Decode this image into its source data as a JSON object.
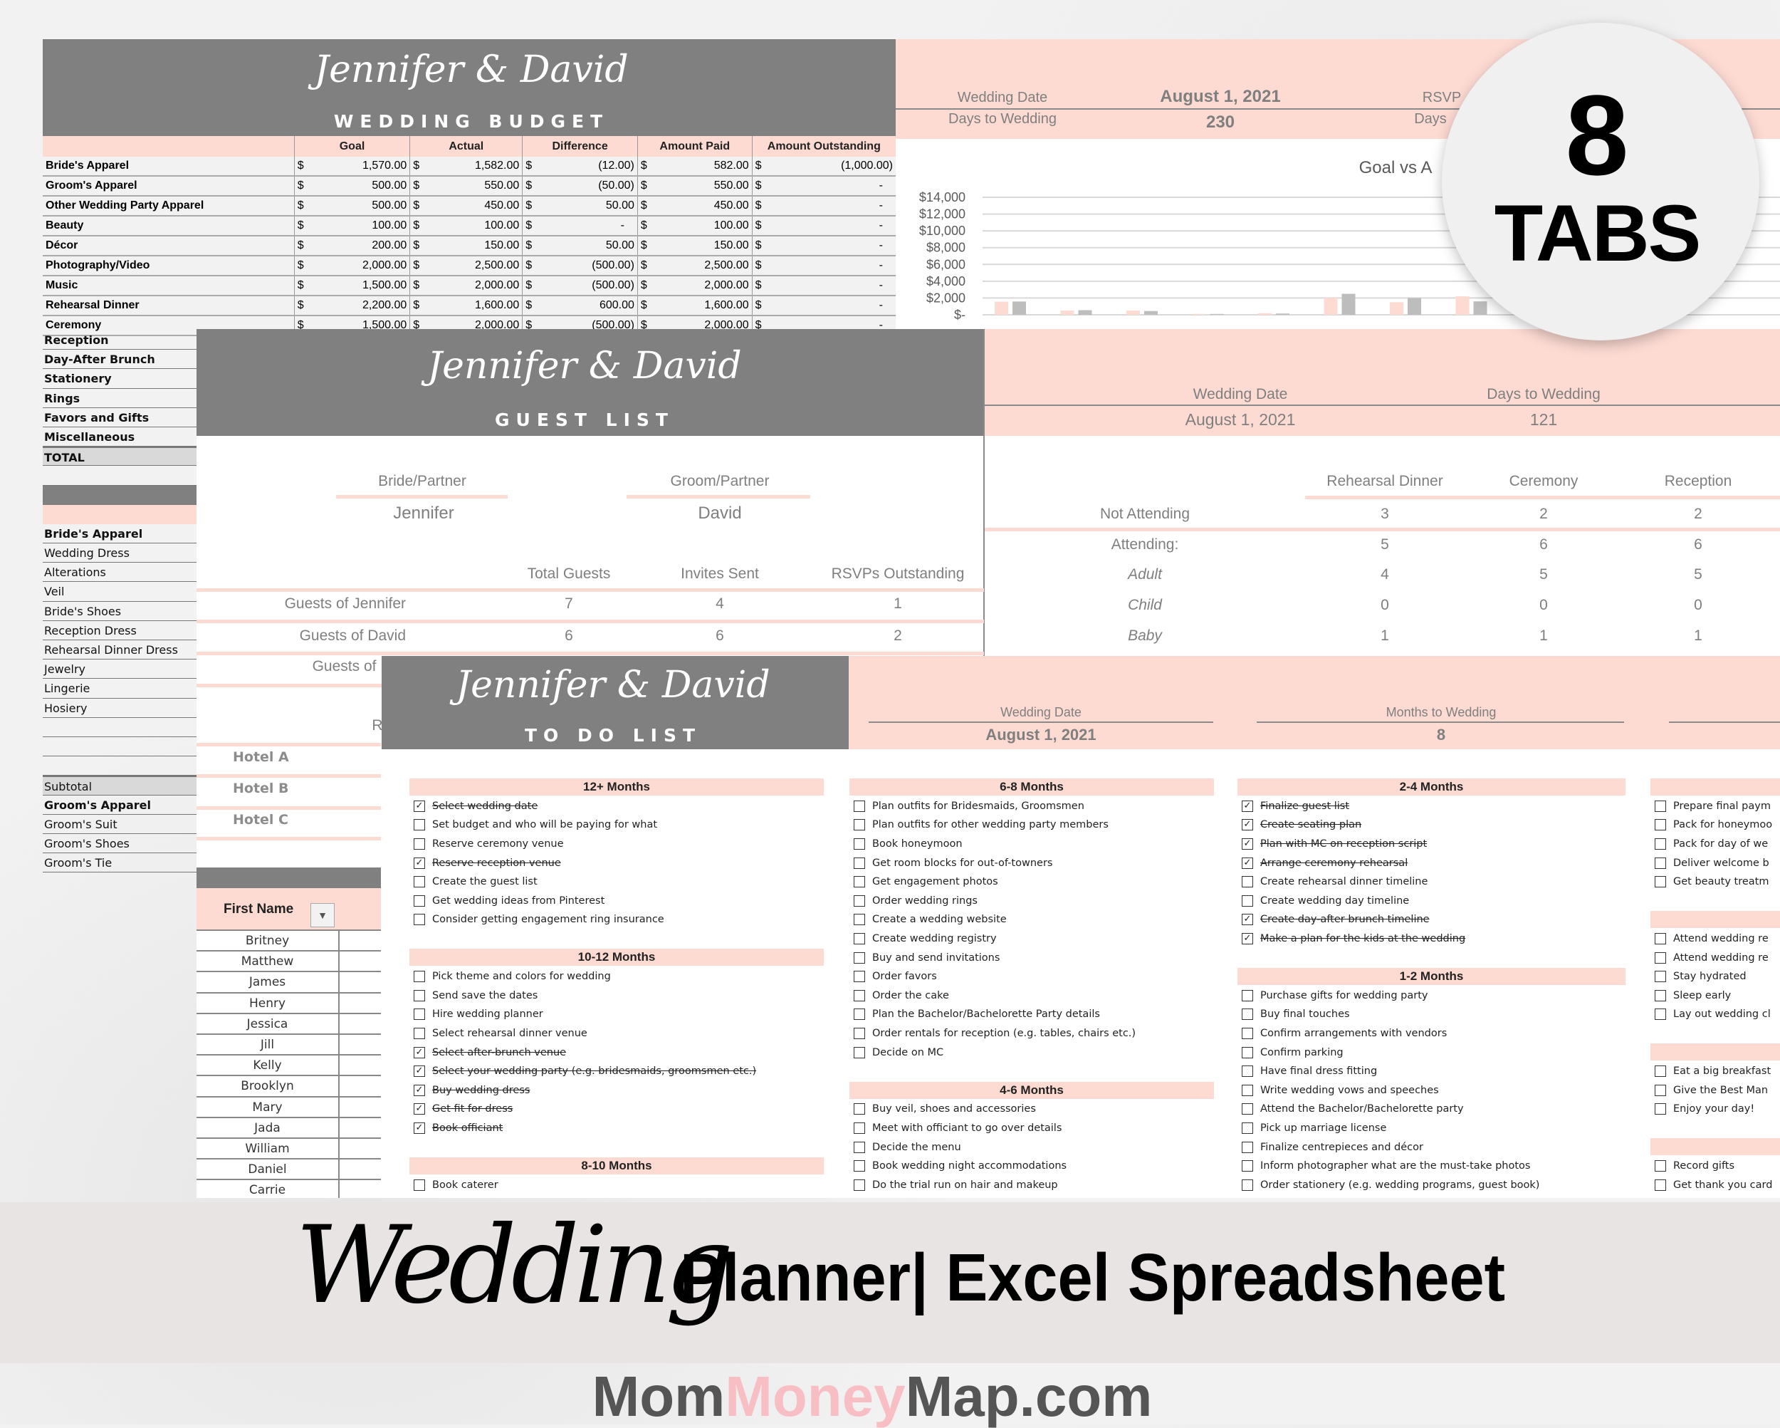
{
  "couple": "Jennifer & David",
  "budget": {
    "subtitle": "WEDDING BUDGET",
    "columns": [
      "",
      "Goal",
      "Actual",
      "Difference",
      "Amount Paid",
      "Amount Outstanding"
    ],
    "currency": "$",
    "rows": [
      [
        "Bride's Apparel",
        "1,570.00",
        "1,582.00",
        "(12.00)",
        "582.00",
        "(1,000.00)"
      ],
      [
        "Groom's Apparel",
        "500.00",
        "550.00",
        "(50.00)",
        "550.00",
        "-"
      ],
      [
        "Other Wedding Party Apparel",
        "500.00",
        "450.00",
        "50.00",
        "450.00",
        "-"
      ],
      [
        "Beauty",
        "100.00",
        "100.00",
        "-",
        "100.00",
        "-"
      ],
      [
        "Décor",
        "200.00",
        "150.00",
        "50.00",
        "150.00",
        "-"
      ],
      [
        "Photography/Video",
        "2,000.00",
        "2,500.00",
        "(500.00)",
        "2,500.00",
        "-"
      ],
      [
        "Music",
        "1,500.00",
        "2,000.00",
        "(500.00)",
        "2,000.00",
        "-"
      ],
      [
        "Rehearsal Dinner",
        "2,200.00",
        "1,600.00",
        "600.00",
        "1,600.00",
        "-"
      ],
      [
        "Ceremony",
        "1,500.00",
        "2,000.00",
        "(500.00)",
        "2,000.00",
        "-"
      ]
    ],
    "left_rows": [
      {
        "label": "Reception",
        "style": "b"
      },
      {
        "label": "Day-After Brunch",
        "style": "b"
      },
      {
        "label": "Stationery",
        "style": "b"
      },
      {
        "label": "Rings",
        "style": "b"
      },
      {
        "label": "Favors and Gifts",
        "style": "b"
      },
      {
        "label": "Miscellaneous",
        "style": "b"
      },
      {
        "label": "TOTAL",
        "style": "total"
      },
      {
        "label": "",
        "style": "blank"
      },
      {
        "label": "",
        "style": "greybar"
      },
      {
        "label": "",
        "style": "pinkbar"
      },
      {
        "label": "Bride's Apparel",
        "style": "b"
      },
      {
        "label": "Wedding Dress",
        "style": "n"
      },
      {
        "label": "Alterations",
        "style": "n"
      },
      {
        "label": "Veil",
        "style": "n"
      },
      {
        "label": "Bride's Shoes",
        "style": "n"
      },
      {
        "label": "Reception Dress",
        "style": "n"
      },
      {
        "label": "Rehearsal Dinner Dress",
        "style": "n"
      },
      {
        "label": "Jewelry",
        "style": "n"
      },
      {
        "label": "Lingerie",
        "style": "n"
      },
      {
        "label": "Hosiery",
        "style": "n"
      },
      {
        "label": "",
        "style": "blank"
      },
      {
        "label": "",
        "style": "blank"
      },
      {
        "label": "",
        "style": "blank"
      },
      {
        "label": "Subtotal",
        "style": "sub"
      },
      {
        "label": "Groom's Apparel",
        "style": "b"
      },
      {
        "label": "Groom's Suit",
        "style": "n"
      },
      {
        "label": "Groom's Shoes",
        "style": "n"
      },
      {
        "label": "Groom's Tie",
        "style": "n"
      },
      {
        "label": "",
        "style": "n"
      }
    ],
    "info": {
      "wedding_date_label": "Wedding Date",
      "wedding_date": "August 1, 2021",
      "days_label": "Days to Wedding",
      "days": "230",
      "rsvp_label_partial": "RSVP",
      "days_label_partial": "Days"
    }
  },
  "chart_data": {
    "type": "bar",
    "title": "Goal vs A",
    "ylim": [
      0,
      14000
    ],
    "yticks": [
      "$14,000",
      "$12,000",
      "$10,000",
      "$8,000",
      "$6,000",
      "$4,000",
      "$2,000",
      "$-"
    ],
    "ytick_values": [
      14000,
      12000,
      10000,
      8000,
      6000,
      4000,
      2000,
      0
    ],
    "grid": true,
    "series": [
      {
        "values": [
          1570,
          500,
          500,
          100,
          200,
          2000,
          1500,
          2200
        ],
        "color": "#fddbd3"
      },
      {
        "values": [
          1582,
          550,
          450,
          100,
          150,
          2500,
          2000,
          1600
        ],
        "color": "#bdbdbd"
      }
    ]
  },
  "guest_list": {
    "subtitle": "GUEST LIST",
    "bride_label": "Bride/Partner",
    "bride": "Jennifer",
    "groom_label": "Groom/Partner",
    "groom": "David",
    "summary_cols": [
      "Total Guests",
      "Invites Sent",
      "RSVPs Outstanding"
    ],
    "summary_rows": [
      {
        "label": "Guests of Jennifer",
        "values": [
          "7",
          "4",
          "1"
        ]
      },
      {
        "label": "Guests of David",
        "values": [
          "6",
          "6",
          "2"
        ]
      },
      {
        "label": "Guests of Bo",
        "values": []
      }
    ],
    "hotel_header_partial": "R",
    "hotels": [
      "Hotel A",
      "Hotel B",
      "Hotel C"
    ],
    "first_name_header": "First Name",
    "names": [
      "Britney",
      "Matthew",
      "James",
      "Henry",
      "Jessica",
      "Jill",
      "Kelly",
      "Brooklyn",
      "Mary",
      "Jada",
      "William",
      "Daniel",
      "Carrie"
    ],
    "info": {
      "wedding_date_label": "Wedding Date",
      "wedding_date": "August 1, 2021",
      "days_label": "Days to Wedding",
      "days": "121"
    },
    "attendance_cols": [
      "Rehearsal Dinner",
      "Ceremony",
      "Reception"
    ],
    "attendance_rows": [
      {
        "label": "Not Attending",
        "italic": false,
        "values": [
          "3",
          "2",
          "2"
        ]
      },
      {
        "label": "Attending:",
        "italic": false,
        "values": [
          "5",
          "6",
          "6"
        ]
      },
      {
        "label": "Adult",
        "italic": true,
        "values": [
          "4",
          "5",
          "5"
        ]
      },
      {
        "label": "Child",
        "italic": true,
        "values": [
          "0",
          "0",
          "0"
        ]
      },
      {
        "label": "Baby",
        "italic": true,
        "values": [
          "1",
          "1",
          "1"
        ]
      }
    ]
  },
  "todo": {
    "subtitle": "TO DO LIST",
    "info": {
      "wedding_date_label": "Wedding Date",
      "wedding_date": "August 1, 2021",
      "months_label": "Months to Wedding",
      "months": "8"
    },
    "columns": [
      {
        "sections": [
          {
            "title": "12+ Months",
            "items": [
              {
                "text": "Select wedding date",
                "done": true
              },
              {
                "text": "Set budget and who will be paying for what",
                "done": false
              },
              {
                "text": "Reserve ceremony venue",
                "done": false
              },
              {
                "text": "Reserve reception venue",
                "done": true
              },
              {
                "text": "Create the guest list",
                "done": false
              },
              {
                "text": "Get wedding ideas from Pinterest",
                "done": false
              },
              {
                "text": "Consider getting engagement ring insurance",
                "done": false
              }
            ]
          },
          {
            "title": "10-12 Months",
            "items": [
              {
                "text": "Pick theme and colors for wedding",
                "done": false
              },
              {
                "text": "Send save the dates",
                "done": false
              },
              {
                "text": "Hire wedding planner",
                "done": false
              },
              {
                "text": "Select rehearsal dinner venue",
                "done": false
              },
              {
                "text": "Select after-brunch venue",
                "done": true
              },
              {
                "text": "Select your wedding party (e.g. bridesmaids, groomsmen etc.)",
                "done": true
              },
              {
                "text": "Buy wedding dress",
                "done": true
              },
              {
                "text": "Get fit for dress",
                "done": true
              },
              {
                "text": "Book officiant",
                "done": true
              }
            ]
          },
          {
            "title": "8-10 Months",
            "items": [
              {
                "text": "Book caterer",
                "done": false
              }
            ]
          }
        ]
      },
      {
        "sections": [
          {
            "title": "6-8 Months",
            "items": [
              {
                "text": "Plan outfits for Bridesmaids, Groomsmen",
                "done": false
              },
              {
                "text": "Plan outfits for other wedding party members",
                "done": false
              },
              {
                "text": "Book honeymoon",
                "done": false
              },
              {
                "text": "Get room blocks for out-of-towners",
                "done": false
              },
              {
                "text": "Get engagement photos",
                "done": false
              },
              {
                "text": "Order wedding rings",
                "done": false
              },
              {
                "text": "Create a wedding website",
                "done": false
              },
              {
                "text": "Create wedding registry",
                "done": false
              },
              {
                "text": "Buy and send invitations",
                "done": false
              },
              {
                "text": "Order favors",
                "done": false
              },
              {
                "text": "Order the cake",
                "done": false
              },
              {
                "text": "Plan the Bachelor/Bachelorette Party details",
                "done": false
              },
              {
                "text": "Order rentals for reception (e.g. tables, chairs etc.)",
                "done": false
              },
              {
                "text": "Decide on MC",
                "done": false
              }
            ]
          },
          {
            "title": "4-6 Months",
            "items": [
              {
                "text": "Buy veil, shoes and accessories",
                "done": false
              },
              {
                "text": "Meet with officiant to go over details",
                "done": false
              },
              {
                "text": "Decide the menu",
                "done": false
              },
              {
                "text": "Book wedding night accommodations",
                "done": false
              },
              {
                "text": "Do the trial run on hair and makeup",
                "done": false
              }
            ]
          }
        ]
      },
      {
        "sections": [
          {
            "title": "2-4 Months",
            "items": [
              {
                "text": "Finalize guest list",
                "done": true
              },
              {
                "text": "Create seating plan",
                "done": true
              },
              {
                "text": "Plan with MC on reception script",
                "done": true
              },
              {
                "text": "Arrange ceremony rehearsal",
                "done": true
              },
              {
                "text": "Create rehearsal dinner timeline",
                "done": false
              },
              {
                "text": "Create wedding day timeline",
                "done": false
              },
              {
                "text": "Create day-after brunch timeline",
                "done": true
              },
              {
                "text": "Make a plan for the kids at the wedding",
                "done": true
              }
            ]
          },
          {
            "title": "1-2 Months",
            "items": [
              {
                "text": "Purchase gifts for wedding party",
                "done": false
              },
              {
                "text": "Buy final touches",
                "done": false
              },
              {
                "text": "Confirm arrangements with vendors",
                "done": false
              },
              {
                "text": "Confirm parking",
                "done": false
              },
              {
                "text": "Have final dress fitting",
                "done": false
              },
              {
                "text": "Write wedding vows and speeches",
                "done": false
              },
              {
                "text": "Attend the Bachelor/Bachelorette party",
                "done": false
              },
              {
                "text": "Pick up marriage license",
                "done": false
              },
              {
                "text": "Finalize centrepieces and décor",
                "done": false
              },
              {
                "text": "Inform photographer what are the must-take photos",
                "done": false
              },
              {
                "text": "Order stationery (e.g. wedding programs, guest book)",
                "done": false
              }
            ]
          }
        ]
      },
      {
        "sections": [
          {
            "title": "",
            "items": [
              {
                "text": "Prepare final paym",
                "done": false
              },
              {
                "text": "Pack for honeymoo",
                "done": false
              },
              {
                "text": "Pack for day of we",
                "done": false
              },
              {
                "text": "Deliver welcome b",
                "done": false
              },
              {
                "text": "Get beauty treatm",
                "done": false
              }
            ]
          },
          {
            "title": "",
            "items": [
              {
                "text": "Attend wedding re",
                "done": false
              },
              {
                "text": "Attend wedding re",
                "done": false
              },
              {
                "text": "Stay hydrated",
                "done": false
              },
              {
                "text": "Sleep early",
                "done": false
              },
              {
                "text": "Lay out wedding cl",
                "done": false
              }
            ]
          },
          {
            "title": "",
            "items": [
              {
                "text": "Eat a big breakfast",
                "done": false
              },
              {
                "text": "Give the Best Man",
                "done": false
              },
              {
                "text": "Enjoy your day!",
                "done": false
              }
            ]
          },
          {
            "title": "",
            "items": [
              {
                "text": "Record gifts",
                "done": false
              },
              {
                "text": "Get thank you card",
                "done": false
              }
            ]
          }
        ]
      }
    ]
  },
  "badge": {
    "number": "8",
    "label": "TABS"
  },
  "banner": {
    "script_word": "Wedding",
    "rest": "Planner| Excel Spreadsheet",
    "site_part1": "Mom",
    "site_part2": "Money",
    "site_part3": "Map.com",
    "accent_color": "#f7bfc4"
  }
}
